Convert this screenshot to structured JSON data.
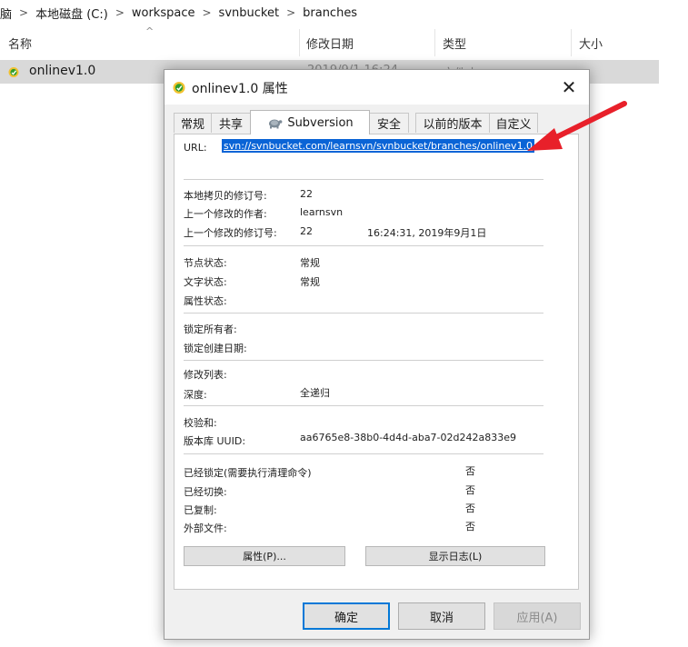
{
  "explorer": {
    "breadcrumb": [
      "脑",
      "本地磁盘 (C:)",
      "workspace",
      "svnbucket",
      "branches"
    ],
    "breadcrumb_sep": ">",
    "columns": [
      "名称",
      "修改日期",
      "类型",
      "大小"
    ],
    "sort_glyph": "^",
    "row": {
      "name": "onlinev1.0",
      "date_faded": "2019/9/1 16:24",
      "type_faded": "文件夹"
    }
  },
  "dialog": {
    "title": "onlinev1.0 属性",
    "close_glyph": "✕",
    "tabs": [
      "常规",
      "共享",
      "Subversion",
      "安全",
      "以前的版本",
      "自定义"
    ],
    "active_tab": "Subversion",
    "url_label": "URL:",
    "url_value": "svn://svnbucket.com/learnsvn/svnbucket/branches/onlinev1.0",
    "rows": [
      {
        "label": "本地拷贝的修订号:",
        "value": "22"
      },
      {
        "label": "上一个修改的作者:",
        "value": "learnsvn"
      },
      {
        "label": "上一个修改的修订号:",
        "value": "22",
        "extra": "16:24:31, 2019年9月1日"
      },
      {
        "label": "节点状态:",
        "value": "常规"
      },
      {
        "label": "文字状态:",
        "value": "常规"
      },
      {
        "label": "属性状态:",
        "value": ""
      },
      {
        "label": "锁定所有者:",
        "value": ""
      },
      {
        "label": "锁定创建日期:",
        "value": ""
      },
      {
        "label": "修改列表:",
        "value": ""
      },
      {
        "label": "深度:",
        "value": "全递归"
      },
      {
        "label": "校验和:",
        "value": ""
      },
      {
        "label": "版本库 UUID:",
        "value": "aa6765e8-38b0-4d4d-aba7-02d242a833e9"
      },
      {
        "label": "已经锁定(需要执行清理命令)",
        "value": "否"
      },
      {
        "label": "已经切换:",
        "value": "否"
      },
      {
        "label": "已复制:",
        "value": "否"
      },
      {
        "label": "外部文件:",
        "value": "否"
      }
    ],
    "properties_button": "属性(P)...",
    "show_log_button": "显示日志(L)",
    "ok_button": "确定",
    "cancel_button": "取消",
    "apply_button": "应用(A)"
  },
  "colors": {
    "selection": "#0a64d6",
    "arrow": "#e8202a",
    "svn_green": "#2e9e2e"
  }
}
